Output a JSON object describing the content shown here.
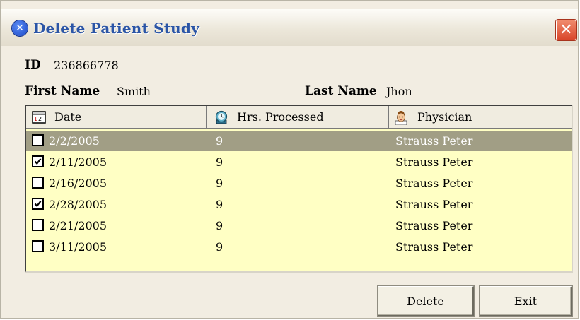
{
  "window": {
    "title": "Delete Patient Study",
    "title_icon": "blue-x-icon",
    "close_label": "✕"
  },
  "patient": {
    "id_label": "ID",
    "id_value": "236866778",
    "first_name_label": "First Name",
    "first_name_value": "Smith",
    "last_name_label": "Last Name",
    "last_name_value": "Jhon"
  },
  "grid": {
    "columns": [
      {
        "label": "Date",
        "icon": "calendar-icon"
      },
      {
        "label": "Hrs. Processed",
        "icon": "clock-icon"
      },
      {
        "label": "Physician",
        "icon": "doctor-icon"
      }
    ],
    "rows": [
      {
        "date": "2/2/2005",
        "hours": "9",
        "physician": "Strauss Peter",
        "checked": false,
        "selected": true
      },
      {
        "date": "2/11/2005",
        "hours": "9",
        "physician": "Strauss Peter",
        "checked": true,
        "selected": false
      },
      {
        "date": "2/16/2005",
        "hours": "9",
        "physician": "Strauss Peter",
        "checked": false,
        "selected": false
      },
      {
        "date": "2/28/2005",
        "hours": "9",
        "physician": "Strauss Peter",
        "checked": true,
        "selected": false
      },
      {
        "date": "2/21/2005",
        "hours": "9",
        "physician": "Strauss Peter",
        "checked": false,
        "selected": false
      },
      {
        "date": "3/11/2005",
        "hours": "9",
        "physician": "Strauss Peter",
        "checked": false,
        "selected": false
      }
    ]
  },
  "buttons": {
    "delete_label": "Delete",
    "exit_label": "Exit"
  },
  "colors": {
    "grid_background": "#ffffc4",
    "selected_row": "#a19e85",
    "title_text": "#2b55a6",
    "close_button": "#d9472c"
  }
}
